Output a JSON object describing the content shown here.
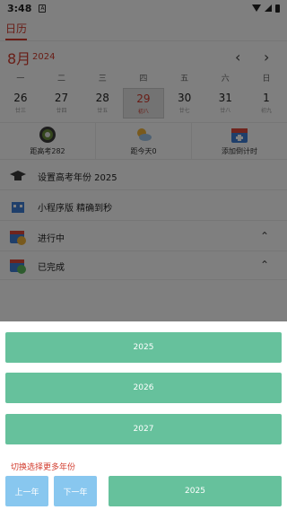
{
  "status_bar": {
    "time": "3:48",
    "notification_glyph": "A"
  },
  "tabs": {
    "calendar": "日历"
  },
  "calendar": {
    "month": "8月",
    "year": "2024",
    "weekdays": [
      "一",
      "二",
      "三",
      "四",
      "五",
      "六",
      "日"
    ],
    "dates": [
      {
        "num": "26",
        "lunar": "廿三"
      },
      {
        "num": "27",
        "lunar": "廿四"
      },
      {
        "num": "28",
        "lunar": "廿五"
      },
      {
        "num": "29",
        "lunar": "初八"
      },
      {
        "num": "30",
        "lunar": "廿七"
      },
      {
        "num": "31",
        "lunar": "廿八"
      },
      {
        "num": "1",
        "lunar": "初九"
      }
    ],
    "selected_index": 3
  },
  "quick_actions": [
    {
      "label": "距高考282",
      "icon": "target-icon"
    },
    {
      "label": "距今天0",
      "icon": "weather-icon"
    },
    {
      "label": "添加倒计时",
      "icon": "calendar-add-icon"
    }
  ],
  "list": [
    {
      "label": "设置高考年份  2025",
      "icon": "graduation-cap-icon"
    },
    {
      "label": "小程序版 精确到秒",
      "icon": "building-icon"
    },
    {
      "label": "进行中",
      "icon": "calendar-clock-icon"
    },
    {
      "label": "已完成",
      "icon": "calendar-check-icon"
    }
  ],
  "sheet": {
    "options": [
      "2025",
      "2026",
      "2027"
    ],
    "hint": "切换选择更多年份",
    "prev_label": "上一年",
    "next_label": "下一年",
    "current_label": "2025"
  },
  "colors": {
    "accent_red": "#d23c2e",
    "option_green": "#66c19c",
    "nav_blue": "#88c7ef",
    "overlay": "rgba(0,0,0,0.5)"
  }
}
